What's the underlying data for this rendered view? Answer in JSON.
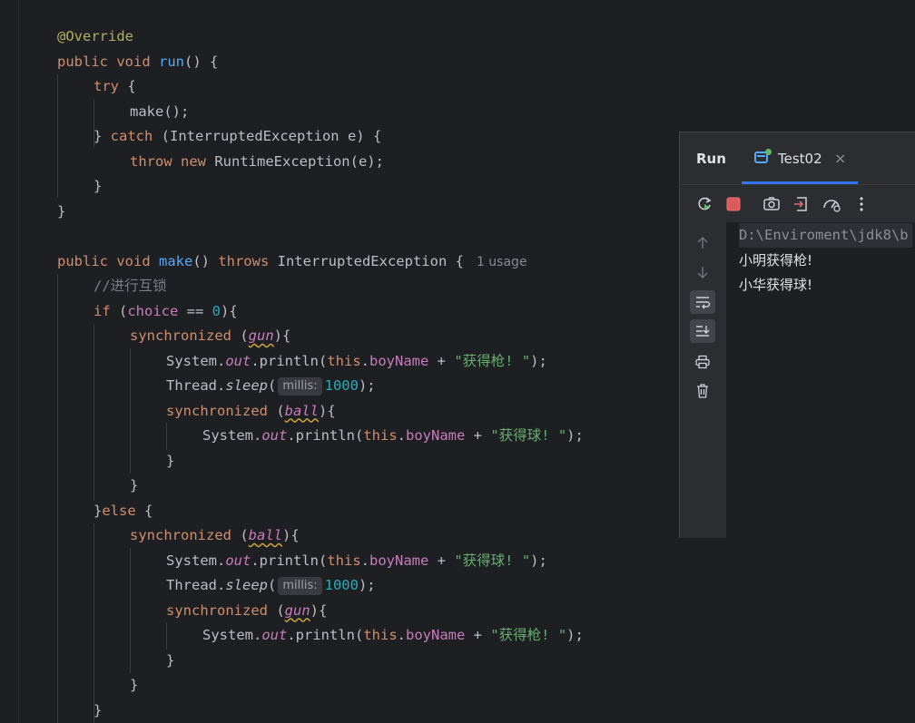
{
  "editor": {
    "lines": [
      {
        "indent": 0,
        "tokens": [
          {
            "t": "@Override",
            "c": "ann"
          }
        ]
      },
      {
        "indent": 0,
        "tokens": [
          {
            "t": "public void ",
            "c": "kw"
          },
          {
            "t": "run",
            "c": "fn"
          },
          {
            "t": "() {",
            "c": ""
          }
        ]
      },
      {
        "indent": 1,
        "tokens": [
          {
            "t": "try",
            "c": "kw"
          },
          {
            "t": " {",
            "c": ""
          }
        ]
      },
      {
        "indent": 2,
        "tokens": [
          {
            "t": "make();",
            "c": ""
          }
        ]
      },
      {
        "indent": 1,
        "tokens": [
          {
            "t": "} ",
            "c": ""
          },
          {
            "t": "catch",
            "c": "kw"
          },
          {
            "t": " (InterruptedException e) {",
            "c": ""
          }
        ]
      },
      {
        "indent": 2,
        "tokens": [
          {
            "t": "throw new",
            "c": "kw"
          },
          {
            "t": " RuntimeException(e);",
            "c": ""
          }
        ]
      },
      {
        "indent": 1,
        "tokens": [
          {
            "t": "}",
            "c": ""
          }
        ]
      },
      {
        "indent": 0,
        "tokens": [
          {
            "t": "}",
            "c": ""
          }
        ]
      },
      {
        "indent": 0,
        "tokens": []
      },
      {
        "indent": 0,
        "tokens": [
          {
            "t": "public void ",
            "c": "kw"
          },
          {
            "t": "make",
            "c": "fn"
          },
          {
            "t": "() ",
            "c": ""
          },
          {
            "t": "throws",
            "c": "kw"
          },
          {
            "t": " InterruptedException {",
            "c": ""
          },
          {
            "t": "1 usage",
            "c": "usage"
          }
        ]
      },
      {
        "indent": 1,
        "tokens": [
          {
            "t": "//进行互锁",
            "c": "cmt"
          }
        ]
      },
      {
        "indent": 1,
        "tokens": [
          {
            "t": "if",
            "c": "kw"
          },
          {
            "t": " (",
            "c": ""
          },
          {
            "t": "choice",
            "c": "fld"
          },
          {
            "t": " == ",
            "c": ""
          },
          {
            "t": "0",
            "c": "num"
          },
          {
            "t": "){",
            "c": ""
          }
        ]
      },
      {
        "indent": 2,
        "tokens": [
          {
            "t": "synchronized",
            "c": "kw"
          },
          {
            "t": " (",
            "c": ""
          },
          {
            "t": "gun",
            "c": "sfld squig"
          },
          {
            "t": "){",
            "c": ""
          }
        ]
      },
      {
        "indent": 3,
        "tokens": [
          {
            "t": "System.",
            "c": ""
          },
          {
            "t": "out",
            "c": "sfld"
          },
          {
            "t": ".println(",
            "c": ""
          },
          {
            "t": "this",
            "c": "kw"
          },
          {
            "t": ".",
            "c": ""
          },
          {
            "t": "boyName",
            "c": "fld"
          },
          {
            "t": " + ",
            "c": ""
          },
          {
            "t": "\"获得枪! \"",
            "c": "str"
          },
          {
            "t": ");",
            "c": ""
          }
        ]
      },
      {
        "indent": 3,
        "tokens": [
          {
            "t": "Thread.",
            "c": ""
          },
          {
            "t": "sleep",
            "c": "smeth"
          },
          {
            "t": "(",
            "c": ""
          },
          {
            "t": "millis:",
            "c": "hint"
          },
          {
            "t": "1000",
            "c": "num"
          },
          {
            "t": ");",
            "c": ""
          }
        ]
      },
      {
        "indent": 3,
        "tokens": [
          {
            "t": "synchronized",
            "c": "kw"
          },
          {
            "t": " (",
            "c": ""
          },
          {
            "t": "ball",
            "c": "sfld squig"
          },
          {
            "t": "){",
            "c": ""
          }
        ]
      },
      {
        "indent": 4,
        "tokens": [
          {
            "t": "System.",
            "c": ""
          },
          {
            "t": "out",
            "c": "sfld"
          },
          {
            "t": ".println(",
            "c": ""
          },
          {
            "t": "this",
            "c": "kw"
          },
          {
            "t": ".",
            "c": ""
          },
          {
            "t": "boyName",
            "c": "fld"
          },
          {
            "t": " + ",
            "c": ""
          },
          {
            "t": "\"获得球! \"",
            "c": "str"
          },
          {
            "t": ");",
            "c": ""
          }
        ]
      },
      {
        "indent": 3,
        "tokens": [
          {
            "t": "}",
            "c": ""
          }
        ]
      },
      {
        "indent": 2,
        "tokens": [
          {
            "t": "}",
            "c": ""
          }
        ]
      },
      {
        "indent": 1,
        "tokens": [
          {
            "t": "}",
            "c": ""
          },
          {
            "t": "else",
            "c": "kw"
          },
          {
            "t": " {",
            "c": ""
          }
        ]
      },
      {
        "indent": 2,
        "tokens": [
          {
            "t": "synchronized",
            "c": "kw"
          },
          {
            "t": " (",
            "c": ""
          },
          {
            "t": "ball",
            "c": "sfld squig"
          },
          {
            "t": "){",
            "c": ""
          }
        ]
      },
      {
        "indent": 3,
        "tokens": [
          {
            "t": "System.",
            "c": ""
          },
          {
            "t": "out",
            "c": "sfld"
          },
          {
            "t": ".println(",
            "c": ""
          },
          {
            "t": "this",
            "c": "kw"
          },
          {
            "t": ".",
            "c": ""
          },
          {
            "t": "boyName",
            "c": "fld"
          },
          {
            "t": " + ",
            "c": ""
          },
          {
            "t": "\"获得球! \"",
            "c": "str"
          },
          {
            "t": ");",
            "c": ""
          }
        ]
      },
      {
        "indent": 3,
        "tokens": [
          {
            "t": "Thread.",
            "c": ""
          },
          {
            "t": "sleep",
            "c": "smeth"
          },
          {
            "t": "(",
            "c": ""
          },
          {
            "t": "millis:",
            "c": "hint"
          },
          {
            "t": "1000",
            "c": "num"
          },
          {
            "t": ");",
            "c": ""
          }
        ]
      },
      {
        "indent": 3,
        "tokens": [
          {
            "t": "synchronized",
            "c": "kw"
          },
          {
            "t": " (",
            "c": ""
          },
          {
            "t": "gun",
            "c": "sfld squig"
          },
          {
            "t": "){",
            "c": ""
          }
        ]
      },
      {
        "indent": 4,
        "tokens": [
          {
            "t": "System.",
            "c": ""
          },
          {
            "t": "out",
            "c": "sfld"
          },
          {
            "t": ".println(",
            "c": ""
          },
          {
            "t": "this",
            "c": "kw"
          },
          {
            "t": ".",
            "c": ""
          },
          {
            "t": "boyName",
            "c": "fld"
          },
          {
            "t": " + ",
            "c": ""
          },
          {
            "t": "\"获得枪! \"",
            "c": "str"
          },
          {
            "t": ");",
            "c": ""
          }
        ]
      },
      {
        "indent": 3,
        "tokens": [
          {
            "t": "}",
            "c": ""
          }
        ]
      },
      {
        "indent": 2,
        "tokens": [
          {
            "t": "}",
            "c": ""
          }
        ]
      },
      {
        "indent": 1,
        "tokens": [
          {
            "t": "}",
            "c": ""
          }
        ]
      }
    ]
  },
  "run_panel": {
    "title": "Run",
    "tab_label": "Test02",
    "tab_close": "×",
    "toolbar_icons": [
      "rerun-icon",
      "stop-icon",
      "screenshot-icon",
      "exit-icon",
      "profiler-icon",
      "more-icon"
    ],
    "side_icons": [
      "arrow-up-icon",
      "arrow-down-icon",
      "soft-wrap-icon",
      "scroll-to-end-icon",
      "print-icon",
      "trash-icon"
    ],
    "console": {
      "path": "D:\\Enviroment\\jdk8\\b",
      "output": [
        "小明获得枪!",
        "小华获得球!"
      ]
    }
  },
  "colors": {
    "background": "#1e1f22",
    "panel": "#2b2d30",
    "keyword": "#cf8e6d",
    "function": "#56a8f5",
    "annotation": "#b3ae60",
    "field": "#c77dbb",
    "string": "#6aab73",
    "number": "#2aacb8",
    "comment": "#7a7e85",
    "accent": "#3574f0",
    "stop": "#e06c75"
  }
}
